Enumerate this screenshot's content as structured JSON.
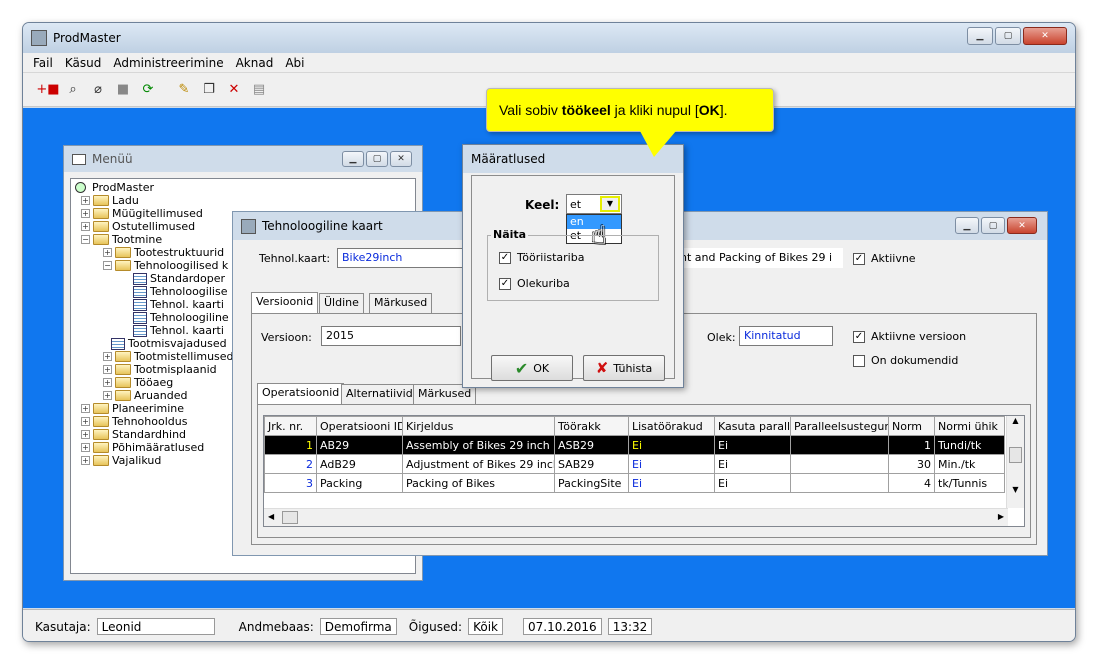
{
  "app": {
    "title": "ProdMaster",
    "menu": [
      "Fail",
      "Käsud",
      "Administreerimine",
      "Aknad",
      "Abi"
    ]
  },
  "callout": {
    "prefix": "Vali sobiv ",
    "bold": "töökeel",
    "middle": " ja kliki nupul [",
    "ok": "OK",
    "suffix": "]."
  },
  "menu_window": {
    "title": "Menüü",
    "items": [
      "ProdMaster",
      "Ladu",
      "Müügitellimused",
      "Ostutellimused",
      "Tootmine",
      "Tootestruktuurid",
      "Tehnoloogilised k",
      "Standardoper",
      "Tehnoloogilise",
      "Tehnol. kaarti",
      "Tehnoloogiline",
      "Tehnol. kaarti",
      "Tootmisvajadused",
      "Tootmistellimused",
      "Tootmisplaanid",
      "Tööaeg",
      "Aruanded",
      "Planeerimine",
      "Tehnohooldus",
      "Standardhind",
      "Põhimääratlused",
      "Vajalikud"
    ]
  },
  "tech_card": {
    "title": "Tehnoloogiline kaart",
    "card_label": "Tehnol.kaart:",
    "card_value": "Bike29inch",
    "description_value": "nt and Packing of Bikes 29 i",
    "active_label": "Aktiivne",
    "tabs": [
      "Versioonid",
      "Üldine",
      "Märkused"
    ],
    "version_label": "Versioon:",
    "version_value": "2015",
    "state_label": "Olek:",
    "state_value": "Kinnitatud",
    "active_version_label": "Aktiivne versioon",
    "has_documents_label": "On dokumendid",
    "subtabs": [
      "Operatsioonid",
      "Alternatiivid",
      "Märkused"
    ],
    "columns": [
      "Jrk. nr.",
      "Operatsiooni ID",
      "Kirjeldus",
      "Töörakk",
      "Lisatöörakud",
      "Kasuta parall.",
      "Paralleelsustegur",
      "Norm",
      "Normi ühik"
    ],
    "rows": [
      [
        "1",
        "AB29",
        "Assembly of Bikes 29 inch",
        "ASB29",
        "Ei",
        "Ei",
        "",
        "1",
        "Tundi/tk"
      ],
      [
        "2",
        "AdB29",
        "Adjustment of Bikes 29 inch",
        "SAB29",
        "Ei",
        "Ei",
        "",
        "30",
        "Min./tk"
      ],
      [
        "3",
        "Packing",
        "Packing of Bikes",
        "PackingSite",
        "Ei",
        "Ei",
        "",
        "4",
        "tk/Tunnis"
      ]
    ]
  },
  "dialog": {
    "title": "Määratlused",
    "lang_label": "Keel:",
    "lang_value": "et",
    "options": [
      "en",
      "et"
    ],
    "group_label": "Näita",
    "toolbar_label": "Tööriistariba",
    "statusbar_label": "Olekuriba",
    "ok_label": "OK",
    "cancel_label": "Tühista"
  },
  "status": {
    "user_label": "Kasutaja:",
    "user_value": "Leonid",
    "db_label": "Andmebaas:",
    "db_value": "Demofirma",
    "rights_label": "Õigused:",
    "rights_value": "Kõik",
    "date": "07.10.2016",
    "time": "13:32"
  },
  "colors": {
    "workspace": "#1077ef",
    "callout": "#ffff00",
    "link_value": "#0a2bdc"
  }
}
